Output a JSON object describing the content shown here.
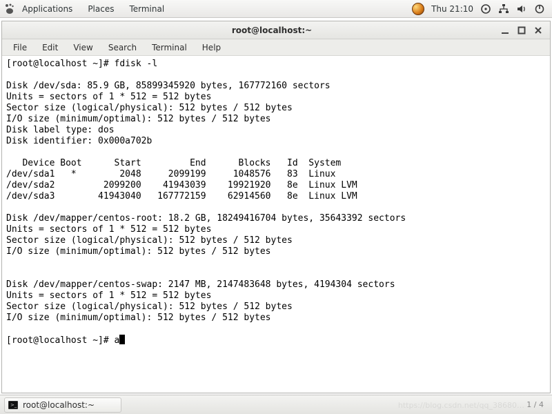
{
  "top_panel": {
    "menus": [
      "Applications",
      "Places",
      "Terminal"
    ],
    "clock": "Thu 21:10"
  },
  "window": {
    "title": "root@localhost:~",
    "menubar": [
      "File",
      "Edit",
      "View",
      "Search",
      "Terminal",
      "Help"
    ]
  },
  "terminal": {
    "prompt1": "[root@localhost ~]# ",
    "cmd1": "fdisk -l",
    "blank": "",
    "sda_header": "Disk /dev/sda: 85.9 GB, 85899345920 bytes, 167772160 sectors",
    "units": "Units = sectors of 1 * 512 = 512 bytes",
    "sector": "Sector size (logical/physical): 512 bytes / 512 bytes",
    "io": "I/O size (minimum/optimal): 512 bytes / 512 bytes",
    "label": "Disk label type: dos",
    "ident": "Disk identifier: 0x000a702b",
    "columns": "   Device Boot      Start         End      Blocks   Id  System",
    "row1": "/dev/sda1   *        2048     2099199     1048576   83  Linux",
    "row2": "/dev/sda2         2099200    41943039    19921920   8e  Linux LVM",
    "row3": "/dev/sda3        41943040   167772159    62914560   8e  Linux LVM",
    "croot_header": "Disk /dev/mapper/centos-root: 18.2 GB, 18249416704 bytes, 35643392 sectors",
    "cswap_header": "Disk /dev/mapper/centos-swap: 2147 MB, 2147483648 bytes, 4194304 sectors",
    "prompt2": "[root@localhost ~]# ",
    "cmd2": "a"
  },
  "taskbar": {
    "button_label": "root@localhost:~",
    "pager": "1 / 4"
  },
  "watermark": "https://blog.csdn.net/qq_38680…"
}
